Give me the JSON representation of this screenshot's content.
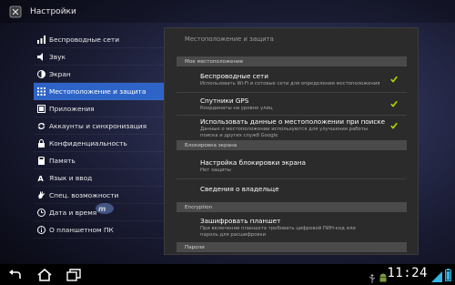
{
  "header": {
    "title": "Настройки"
  },
  "sidebar": {
    "items": [
      {
        "label": "Беспроводные сети",
        "icon": "wireless-icon"
      },
      {
        "label": "Звук",
        "icon": "volume-icon"
      },
      {
        "label": "Экран",
        "icon": "brightness-icon"
      },
      {
        "label": "Местоположение и защита",
        "icon": "location-grid-icon",
        "active": true
      },
      {
        "label": "Приложения",
        "icon": "apps-icon"
      },
      {
        "label": "Аккаунты и синхронизация",
        "icon": "sync-icon"
      },
      {
        "label": "Конфиденциальность",
        "icon": "privacy-icon"
      },
      {
        "label": "Память",
        "icon": "storage-icon"
      },
      {
        "label": "Язык и ввод",
        "icon": "language-icon"
      },
      {
        "label": "Спец. возможности",
        "icon": "accessibility-icon"
      },
      {
        "label": "Дата и время",
        "icon": "clock-icon"
      },
      {
        "label": "О планшетном ПК",
        "icon": "info-icon"
      }
    ]
  },
  "panel": {
    "title": "Местоположение и защита",
    "cat_location": "Мое местоположение",
    "wifi_title": "Беспроводные сети",
    "wifi_summary": "Использовать Wi-Fi и сотовые сети для определения местоположения",
    "gps_title": "Спутники GPS",
    "gps_summary": "Координаты на уровне улиц",
    "loc_data_title": "Использовать данные о местоположении при поиске",
    "loc_data_summary": "Данные о местоположении используются для улучшения работы поиска и других служб Google",
    "cat_lock": "Блокировка экрана",
    "lock_title": "Настройка блокировки экрана",
    "lock_summary": "Нет защиты",
    "owner_title": "Сведения о владельце",
    "cat_encryption": "Encryption",
    "encrypt_title": "Зашифровать планшет",
    "encrypt_summary": "При включении планшета требовать цифровой ПИН-код или пароль для расшифровки",
    "cat_passwords": "Пароли"
  },
  "statusbar": {
    "time": "11:24"
  },
  "colors": {
    "accent": "#2e64c8",
    "check": "#b8d500"
  }
}
